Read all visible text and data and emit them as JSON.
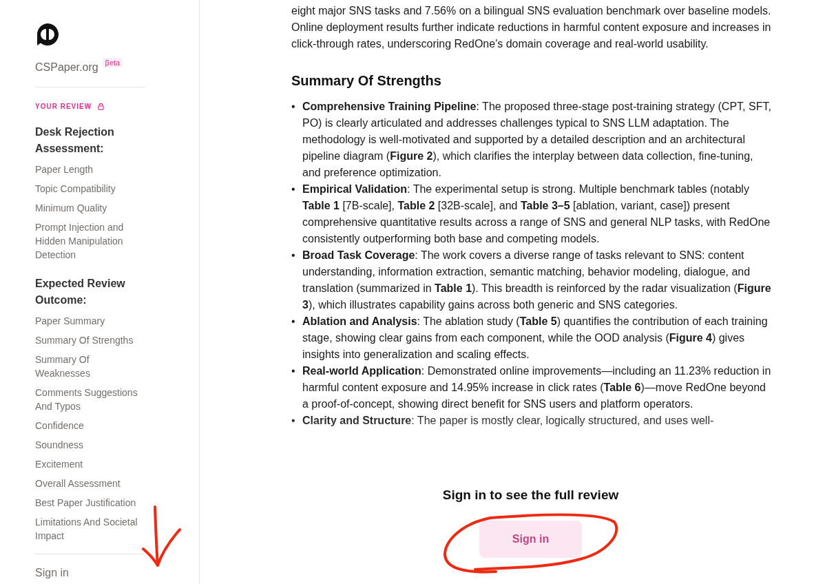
{
  "sidebar": {
    "brand": "CSPaper.org",
    "badge": "βeta",
    "section_label": "YOUR REVIEW",
    "groups": [
      {
        "heading": "Desk Rejection Assessment:",
        "items": [
          "Paper Length",
          "Topic Compatibility",
          "Minimum Quality",
          "Prompt Injection and Hidden Manipulation Detection"
        ]
      },
      {
        "heading": "Expected Review Outcome:",
        "items": [
          "Paper Summary",
          "Summary Of Strengths",
          "Summary Of Weaknesses",
          "Comments Suggestions And Typos",
          "Confidence",
          "Soundness",
          "Excitement",
          "Overall Assessment",
          "Best Paper Justification",
          "Limitations And Societal Impact"
        ]
      }
    ],
    "sign_in": "Sign in"
  },
  "main": {
    "intro": "eight major SNS tasks and 7.56% on a bilingual SNS evaluation benchmark over baseline models. Online deployment results further indicate reductions in harmful content exposure and increases in click-through rates, underscoring RedOne's domain coverage and real-world usability.",
    "heading": "Summary Of Strengths",
    "bullet": "•",
    "strengths": [
      "**Comprehensive Training Pipeline**: The proposed three-stage post-training strategy (CPT, SFT, PO) is clearly articulated and addresses challenges typical to SNS LLM adaptation. The methodology is well-motivated and supported by a detailed description and an architectural pipeline diagram (**Figure 2**), which clarifies the interplay between data collection, fine-tuning, and preference optimization.",
      "**Empirical Validation**: The experimental setup is strong. Multiple benchmark tables (notably **Table 1** [7B-scale], **Table 2** [32B-scale], and **Table 3–5** [ablation, variant, case]) present comprehensive quantitative results across a range of SNS and general NLP tasks, with RedOne consistently outperforming both base and competing models.",
      "**Broad Task Coverage**: The work covers a diverse range of tasks relevant to SNS: content understanding, information extraction, semantic matching, behavior modeling, dialogue, and translation (summarized in **Table 1**). This breadth is reinforced by the radar visualization (**Figure 3**), which illustrates capability gains across both generic and SNS categories.",
      "**Ablation and Analysis**: The ablation study (**Table 5**) quantifies the contribution of each training stage, showing clear gains from each component, while the OOD analysis (**Figure 4**) gives insights into generalization and scaling effects.",
      "**Real-world Application**: Demonstrated online improvements—including an 11.23% reduction in harmful content exposure and 14.95% increase in click rates (**Table 6**)—move RedOne beyond a proof-of-concept, showing direct benefit for SNS users and platform operators.",
      "**Clarity and Structure**: The paper is mostly clear, logically structured, and uses well-"
    ],
    "gate_title": "Sign in to see the full review",
    "gate_button": "Sign in"
  }
}
